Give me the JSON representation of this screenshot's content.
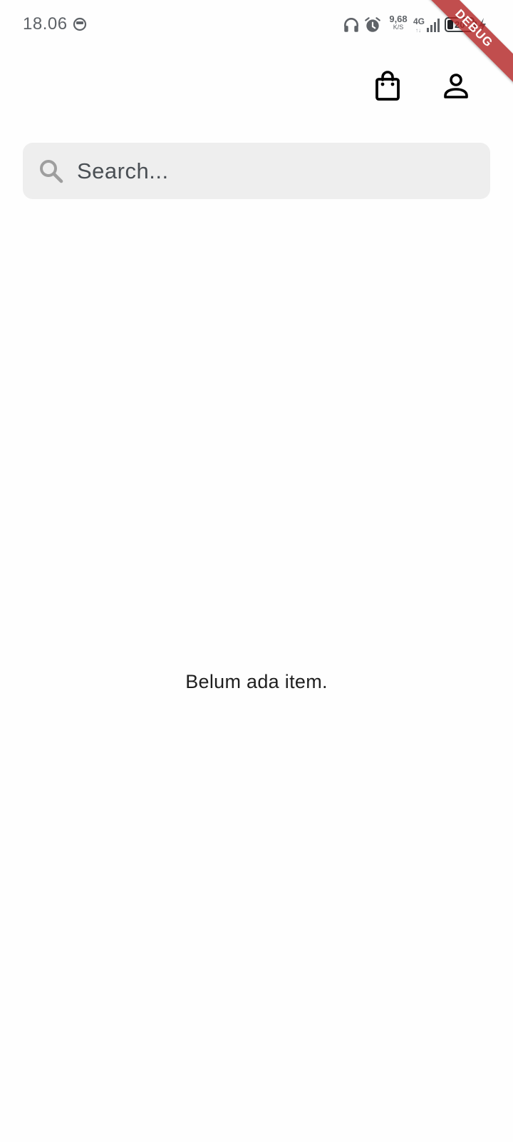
{
  "status_bar": {
    "time": "18.06",
    "network_speed_value": "9,68",
    "network_speed_unit": "K/S",
    "network_type": "4G",
    "network_arrows": "↑↓",
    "battery_level": "20",
    "icons": [
      "notification-icon",
      "headset-icon",
      "alarm-icon",
      "signal-icon",
      "battery-icon",
      "charging-icon"
    ]
  },
  "debug_banner": {
    "label": "DEBUG",
    "color": "#b22222"
  },
  "app_bar": {
    "cart_icon": "shopping-bag-icon",
    "profile_icon": "person-icon"
  },
  "search": {
    "placeholder": "Search...",
    "value": "",
    "icon": "search-icon"
  },
  "content": {
    "empty_message": "Belum ada item."
  },
  "colors": {
    "background": "#fefefe",
    "search_background": "#eeeeee",
    "icon_color": "#000000",
    "text_color": "#1f1f1f"
  }
}
